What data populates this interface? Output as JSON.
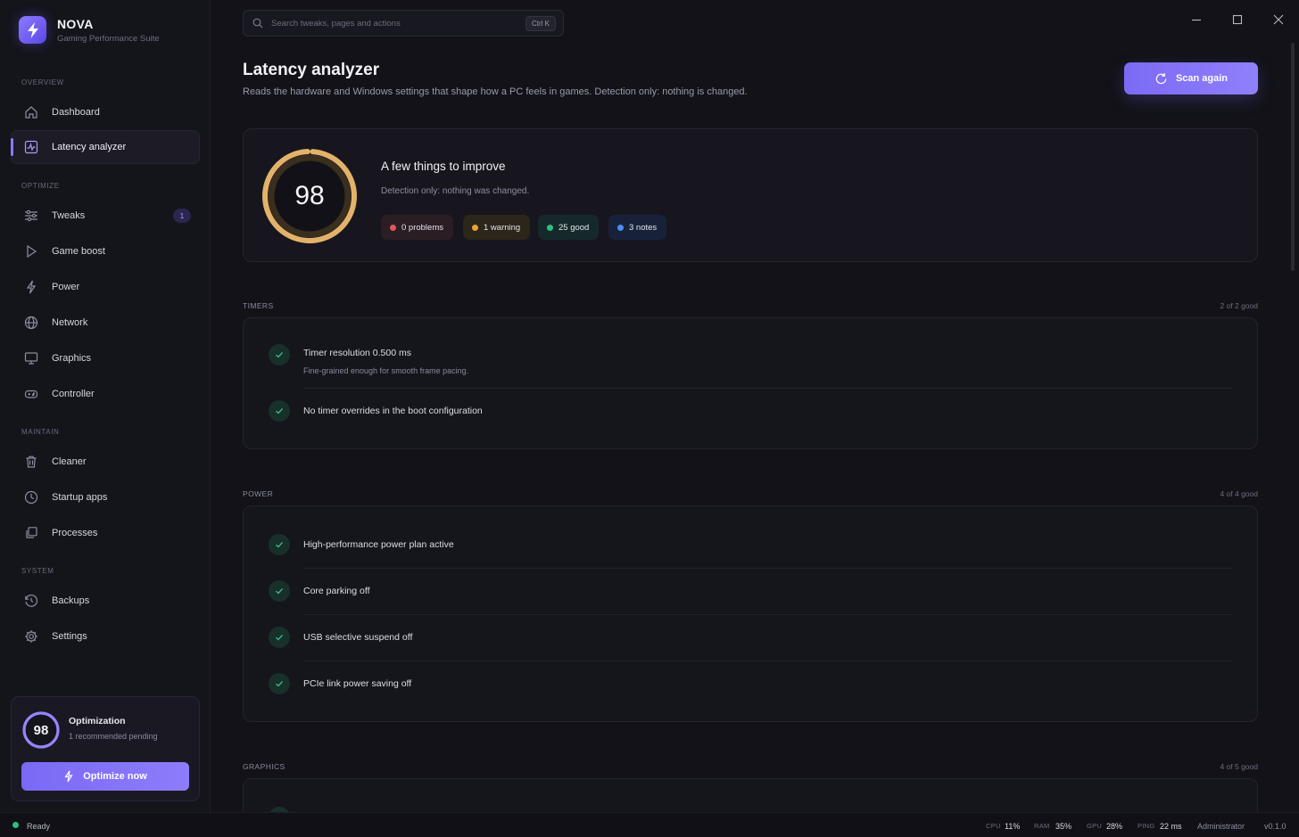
{
  "app": {
    "name": "NOVA",
    "subtitle": "Gaming Performance Suite"
  },
  "colors": {
    "accent": "#8b7bff",
    "problem": "#e5555e",
    "warning": "#e8a23a",
    "good": "#2fbf7e",
    "note": "#4a8ef0",
    "score_ring": "#e3b26a"
  },
  "sidebar": {
    "sections": [
      {
        "label": "OVERVIEW"
      },
      {
        "label": "OPTIMIZE"
      },
      {
        "label": "MAINTAIN"
      },
      {
        "label": "SYSTEM"
      }
    ],
    "items": [
      {
        "label": "Dashboard",
        "icon": "home-icon"
      },
      {
        "label": "Latency analyzer",
        "icon": "activity-icon",
        "active": true
      },
      {
        "label": "Tweaks",
        "icon": "sliders-icon",
        "badge": "1"
      },
      {
        "label": "Game boost",
        "icon": "play-icon"
      },
      {
        "label": "Power",
        "icon": "bolt-icon"
      },
      {
        "label": "Network",
        "icon": "globe-icon"
      },
      {
        "label": "Graphics",
        "icon": "monitor-icon"
      },
      {
        "label": "Controller",
        "icon": "gamepad-icon"
      },
      {
        "label": "Cleaner",
        "icon": "trash-icon"
      },
      {
        "label": "Startup apps",
        "icon": "clock-icon"
      },
      {
        "label": "Processes",
        "icon": "layers-icon"
      },
      {
        "label": "Backups",
        "icon": "history-icon"
      },
      {
        "label": "Settings",
        "icon": "gear-icon"
      }
    ],
    "optimization": {
      "score": "98",
      "level": 0.98,
      "title": "Optimization",
      "subtitle": "1 recommended pending",
      "button": "Optimize now"
    }
  },
  "search": {
    "placeholder": "Search tweaks, pages and actions",
    "shortcut": "Ctrl K"
  },
  "page": {
    "title": "Latency analyzer",
    "subtitle": "Reads the hardware and Windows settings that shape how a PC feels in games. Detection only: nothing is changed.",
    "scan_button": "Scan again"
  },
  "summary": {
    "score": "98",
    "level": 0.98,
    "title": "A few things to improve",
    "subtitle": "Detection only: nothing was changed.",
    "pills": [
      {
        "label": "0 problems",
        "color": "#e5555e"
      },
      {
        "label": "1 warning",
        "color": "#e8a23a"
      },
      {
        "label": "25 good",
        "color": "#2fbf7e"
      },
      {
        "label": "3 notes",
        "color": "#4a8ef0"
      }
    ]
  },
  "sections": [
    {
      "label": "TIMERS",
      "count": "2 of 2 good",
      "rows": [
        {
          "title": "Timer resolution 0.500 ms",
          "desc": "Fine-grained enough for smooth frame pacing."
        },
        {
          "title": "No timer overrides in the boot configuration",
          "desc": ""
        }
      ]
    },
    {
      "label": "POWER",
      "count": "4 of 4 good",
      "rows": [
        {
          "title": "High-performance power plan active",
          "desc": ""
        },
        {
          "title": "Core parking off",
          "desc": ""
        },
        {
          "title": "USB selective suspend off",
          "desc": ""
        },
        {
          "title": "PCIe link power saving off",
          "desc": ""
        }
      ]
    },
    {
      "label": "GRAPHICS",
      "count": "4 of 5 good",
      "rows": []
    }
  ],
  "statusbar": {
    "status": "Ready",
    "cpu_label": "CPU",
    "cpu": "11%",
    "ram_label": "RAM",
    "ram": "35%",
    "gpu_label": "GPU",
    "gpu": "28%",
    "ping_label": "PING",
    "ping": "22 ms",
    "role": "Administrator",
    "version": "v0.1.0"
  }
}
